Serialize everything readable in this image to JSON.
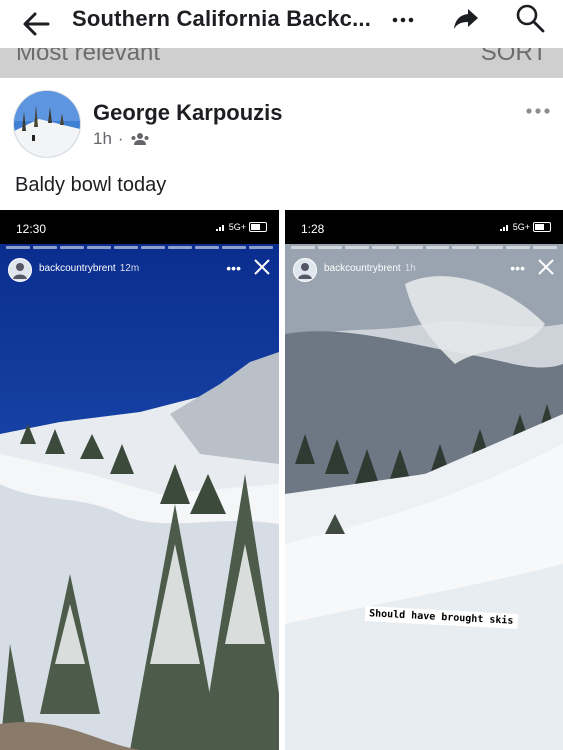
{
  "topbar": {
    "title": "Southern California Backc...",
    "back_icon": "back-arrow-icon",
    "more_icon": "more-dots-icon",
    "share_icon": "share-icon",
    "search_icon": "search-icon"
  },
  "sortbar": {
    "left_label": "Most relevant",
    "right_label": "SORT"
  },
  "post": {
    "author": "George Karpouzis",
    "time": "1h",
    "separator": "·",
    "audience_icon": "group-icon",
    "text": "Baldy bowl today"
  },
  "stories": [
    {
      "time": "12:30",
      "network": "5G+",
      "username": "backcountrybrent",
      "age": "12m"
    },
    {
      "time": "1:28",
      "network": "5G+",
      "username": "backcountrybrent",
      "age": "1h",
      "caption": "Should have brought skis"
    }
  ]
}
